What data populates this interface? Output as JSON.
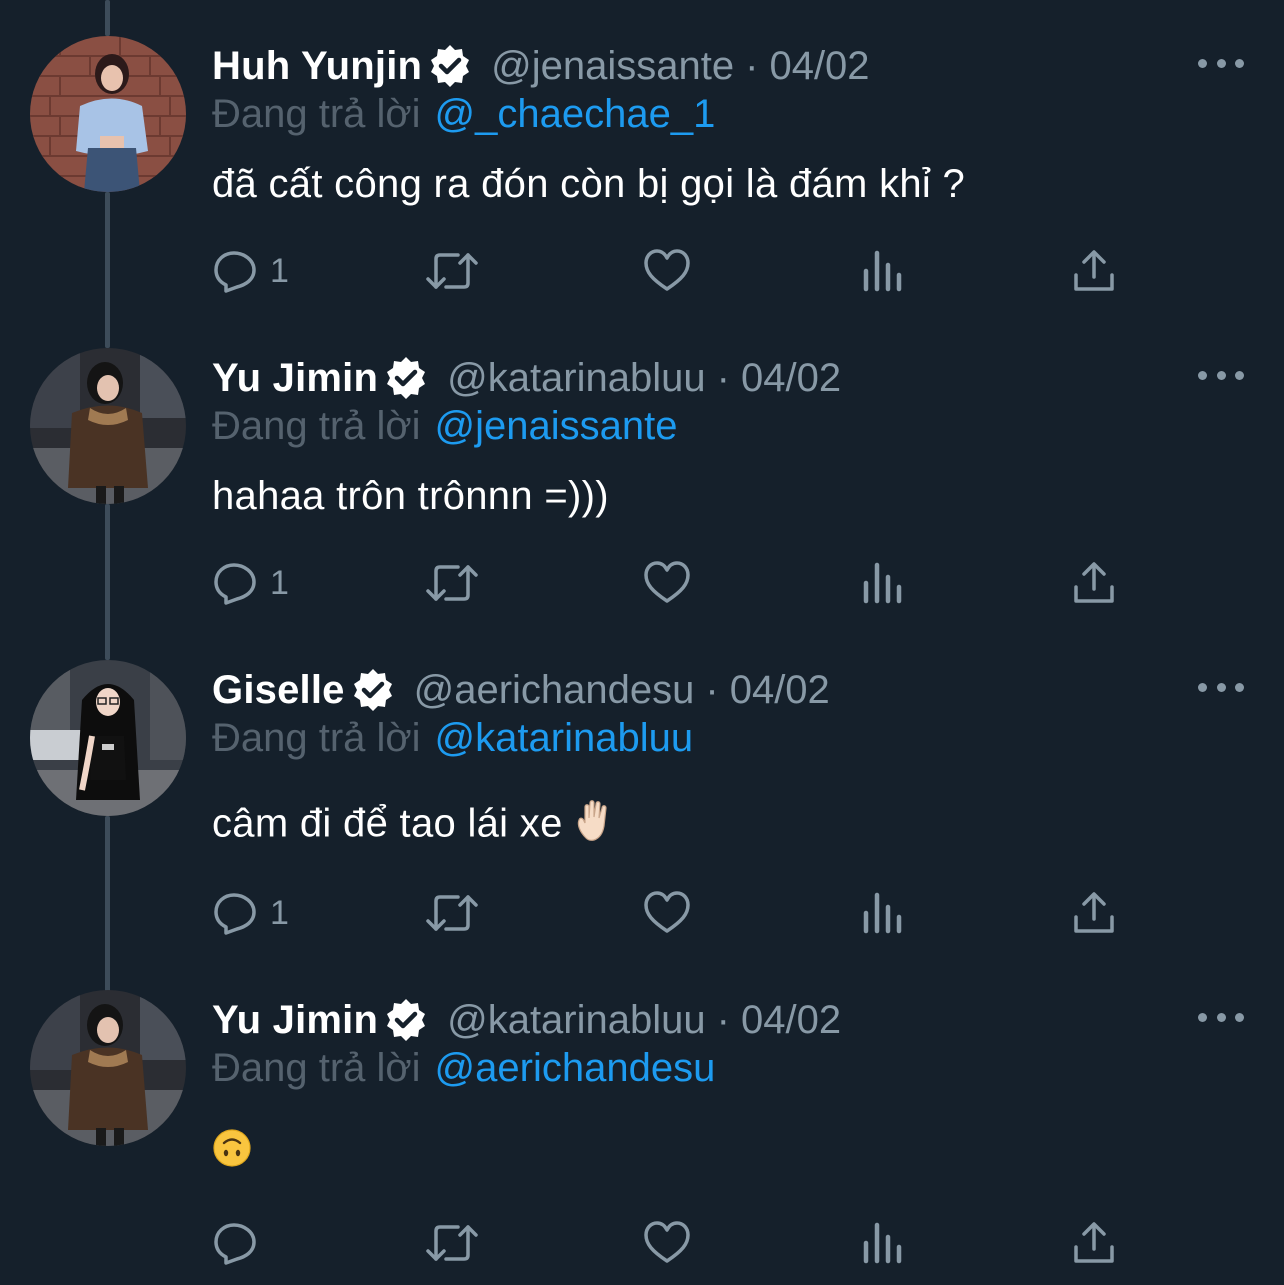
{
  "tweets": [
    {
      "name": "Huh Yunjin",
      "handle": "@jenaissante",
      "separator": "·",
      "date": "04/02",
      "reply_prefix": "Đang trả lời",
      "reply_to": "@_chaechae_1",
      "text": "đã cất công ra đón còn bị gọi là đám khỉ ?",
      "reply_count": "1",
      "avatar": "avatar-woman-blue-shirt-brick-wall"
    },
    {
      "name": "Yu Jimin",
      "handle": "@katarinabluu",
      "separator": "·",
      "date": "04/02",
      "reply_prefix": "Đang trả lời",
      "reply_to": "@jenaissante",
      "text": "hahaa trôn trônnn =)))",
      "reply_count": "1",
      "avatar": "avatar-woman-brown-coat-street"
    },
    {
      "name": "Giselle",
      "handle": "@aerichandesu",
      "separator": "·",
      "date": "04/02",
      "reply_prefix": "Đang trả lời",
      "reply_to": "@katarinabluu",
      "text": "câm đi để tao lái xe",
      "emoji": "raised-hand-emoji",
      "reply_count": "1",
      "avatar": "avatar-woman-black-top-glasses-street"
    },
    {
      "name": "Yu Jimin",
      "handle": "@katarinabluu",
      "separator": "·",
      "date": "04/02",
      "reply_prefix": "Đang trả lời",
      "reply_to": "@aerichandesu",
      "text": "",
      "emoji": "upside-down-face-emoji",
      "reply_count": "",
      "avatar": "avatar-woman-brown-coat-street"
    }
  ],
  "icons": {
    "reply": "reply-icon",
    "retweet": "retweet-icon",
    "like": "heart-icon",
    "views": "views-icon",
    "share": "share-icon",
    "more": "more-icon",
    "verified": "verified-badge-icon"
  },
  "colors": {
    "background": "#15202b",
    "primary_text": "#ffffff",
    "secondary_text": "#8899a6",
    "link": "#1d9bf0",
    "thread_line": "#3d4c5a"
  }
}
